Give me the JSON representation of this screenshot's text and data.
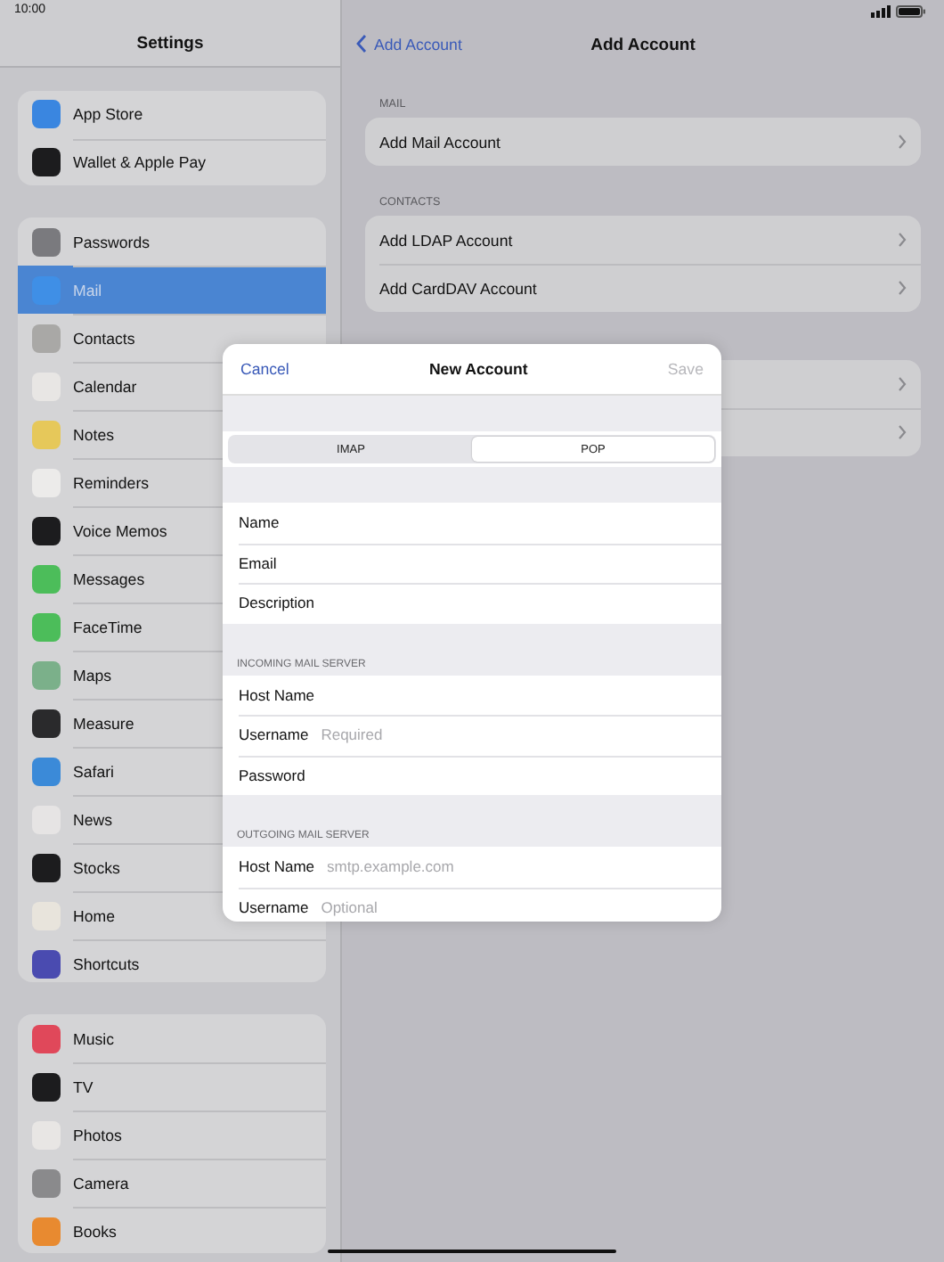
{
  "status_bar": {
    "time": "10:00"
  },
  "sidebar": {
    "title": "Settings",
    "groups": [
      [
        {
          "label": "App Store",
          "color": "#3a86e0",
          "selected": false
        },
        {
          "label": "Wallet & Apple Pay",
          "color": "#1c1c1e",
          "selected": false
        }
      ],
      [
        {
          "label": "Passwords",
          "color": "#7a7a7e",
          "selected": false
        },
        {
          "label": "Mail",
          "color": "#3f8fe6",
          "selected": true
        },
        {
          "label": "Contacts",
          "color": "#a9a8a6",
          "selected": false
        },
        {
          "label": "Calendar",
          "color": "#e8e6e4",
          "selected": false
        },
        {
          "label": "Notes",
          "color": "#e6c85a",
          "selected": false
        },
        {
          "label": "Reminders",
          "color": "#ecebea",
          "selected": false
        },
        {
          "label": "Voice Memos",
          "color": "#1c1c1e",
          "selected": false
        },
        {
          "label": "Messages",
          "color": "#4cbd5a",
          "selected": false
        },
        {
          "label": "FaceTime",
          "color": "#4cbd5a",
          "selected": false
        },
        {
          "label": "Maps",
          "color": "#7bb08a",
          "selected": false
        },
        {
          "label": "Measure",
          "color": "#2a2a2c",
          "selected": false
        },
        {
          "label": "Safari",
          "color": "#3b8ad8",
          "selected": false
        },
        {
          "label": "News",
          "color": "#e6e4e4",
          "selected": false
        },
        {
          "label": "Stocks",
          "color": "#1c1c1e",
          "selected": false
        },
        {
          "label": "Home",
          "color": "#e8e4dc",
          "selected": false
        },
        {
          "label": "Shortcuts",
          "color": "#4a4bb0",
          "selected": false
        }
      ],
      [
        {
          "label": "Music",
          "color": "#e0485a",
          "selected": false
        },
        {
          "label": "TV",
          "color": "#1c1c1e",
          "selected": false
        },
        {
          "label": "Photos",
          "color": "#e8e6e4",
          "selected": false
        },
        {
          "label": "Camera",
          "color": "#8a8a8c",
          "selected": false
        },
        {
          "label": "Books",
          "color": "#e88a30",
          "selected": false
        }
      ]
    ]
  },
  "main": {
    "back_label": "Add Account",
    "title": "Add Account",
    "sections": [
      {
        "header": "MAIL",
        "rows": [
          {
            "label": "Add Mail Account"
          }
        ]
      },
      {
        "header": "CONTACTS",
        "rows": [
          {
            "label": "Add LDAP Account"
          },
          {
            "label": "Add CardDAV Account"
          }
        ]
      }
    ]
  },
  "modal": {
    "cancel": "Cancel",
    "title": "New Account",
    "save": {
      "label": "Save",
      "disabled": true
    },
    "segments": [
      {
        "label": "IMAP",
        "selected": false
      },
      {
        "label": "POP",
        "selected": true
      }
    ],
    "groups": [
      {
        "fields": [
          {
            "label": "Name"
          },
          {
            "label": "Email"
          },
          {
            "label": "Description"
          }
        ]
      },
      {
        "header": "INCOMING MAIL SERVER",
        "fields": [
          {
            "label": "Host Name"
          },
          {
            "label": "Username",
            "placeholder": "Required"
          },
          {
            "label": "Password"
          }
        ]
      },
      {
        "header": "OUTGOING MAIL SERVER",
        "fields": [
          {
            "label": "Host Name",
            "placeholder": "smtp.example.com"
          },
          {
            "label": "Username",
            "placeholder": "Optional"
          }
        ]
      }
    ]
  }
}
